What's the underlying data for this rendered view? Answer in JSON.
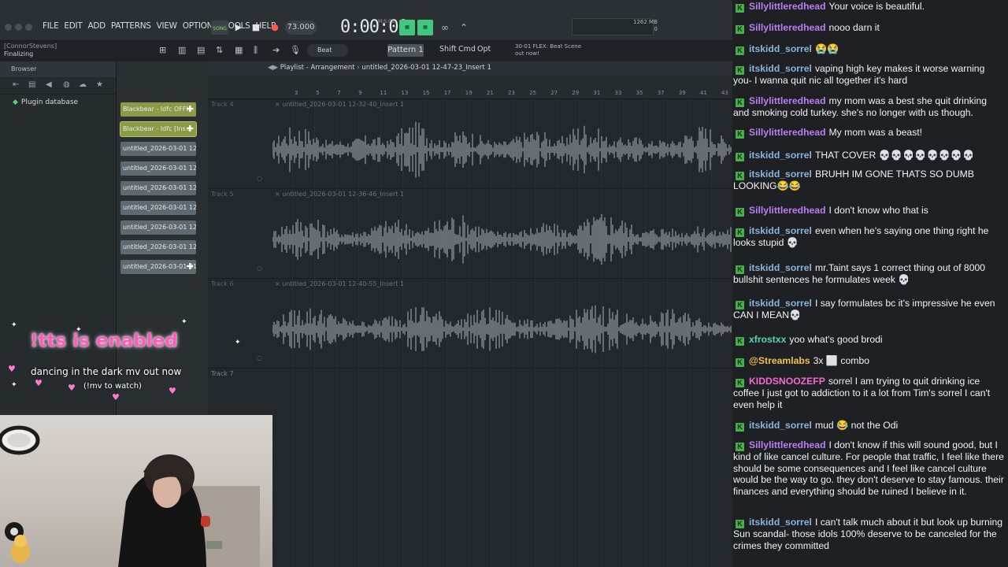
{
  "menu": {
    "items": [
      "FILE",
      "EDIT",
      "ADD",
      "PATTERNS",
      "VIEW",
      "OPTIONS",
      "TOOLS",
      "HELP"
    ],
    "song_label": "SONG",
    "tempo": "73.000",
    "time": "0:00:00",
    "time_unit": "M:S:CS",
    "cpu": "0",
    "ram": "1262 MB",
    "ram2": "0"
  },
  "user": {
    "name": "[ConnorStevens]",
    "status": "Finalizing"
  },
  "toolbar": {
    "beat": "Beat",
    "pattern": "Pattern 1",
    "shift": "Shift",
    "cmd": "Cmd",
    "opt": "Opt",
    "news_line1": "30-01 FLEX: Beat Scene",
    "news_line2": "out now!"
  },
  "browser": {
    "title": "Browser",
    "plugin_db": "Plugin database"
  },
  "channels": [
    {
      "label": "Blackbear - Idfc OFFI...",
      "color": "yellow"
    },
    {
      "label": "Blackbear - Idfc [Ins...",
      "color": "yellow"
    },
    {
      "label": "untitled_2026-03-01 12-...",
      "color": "gray"
    },
    {
      "label": "untitled_2026-03-01 12-...",
      "color": "gray"
    },
    {
      "label": "untitled_2026-03-01 12-...",
      "color": "gray"
    },
    {
      "label": "untitled_2026-03-01 12-...",
      "color": "gray"
    },
    {
      "label": "untitled_2026-03-01 12-...",
      "color": "gray"
    },
    {
      "label": "untitled_2026-03-01 12-...",
      "color": "gray"
    },
    {
      "label": "untitled_2026-03-01 01...",
      "color": "gray"
    }
  ],
  "playlist": {
    "title": "Playlist - Arrangement",
    "file": "untitled_2026-03-01 12-47-23_Insert 1",
    "ticks": [
      "3",
      "5",
      "7",
      "9",
      "11",
      "13",
      "15",
      "17",
      "19",
      "21",
      "23",
      "25",
      "27",
      "29",
      "31",
      "33",
      "35",
      "37",
      "39",
      "41",
      "43"
    ],
    "tracks": [
      {
        "label": "Track 4",
        "clip": "untitled_2026-03-01 12-32-40_Insert 1"
      },
      {
        "label": "Track 5",
        "clip": "untitled_2026-03-01 12-36-46_Insert 1"
      },
      {
        "label": "Track 6",
        "clip": "untitled_2026-03-01 12-40-55_Insert 1"
      }
    ],
    "empty_track": "Track 7"
  },
  "overlay": {
    "tts": "!tts is enabled",
    "mv": "dancing in the dark mv out now",
    "mv_sub": "(!mv to watch)"
  },
  "chat": [
    {
      "user": "Sillylittleredhead",
      "color": "purple",
      "text": "Your voice is beautiful."
    },
    {
      "user": "Sillylittleredhead",
      "color": "purple",
      "text": "nooo darn it"
    },
    {
      "user": "itskidd_sorrel",
      "color": "blue",
      "text": "😭😭"
    },
    {
      "user": "itskidd_sorrel",
      "color": "blue",
      "text": "vaping high key makes it worse warning you- I wanna quit nic all together it's hard"
    },
    {
      "user": "Sillylittleredhead",
      "color": "purple",
      "text": "my mom was a best she quit drinking and smoking cold turkey. she's no longer with us though."
    },
    {
      "user": "Sillylittleredhead",
      "color": "purple",
      "text": "My mom was a beast!"
    },
    {
      "user": "itskidd_sorrel",
      "color": "blue",
      "text": "THAT COVER 💀💀💀💀💀💀💀💀"
    },
    {
      "user": "itskidd_sorrel",
      "color": "blue",
      "text": "BRUHH IM GONE THATS SO DUMB LOOKING😂😂"
    },
    {
      "user": "Sillylittleredhead",
      "color": "purple",
      "text": "I don't know who that is"
    },
    {
      "user": "itskidd_sorrel",
      "color": "blue",
      "text": "even when he's saying one thing right he looks stupid 💀"
    },
    {
      "user": "itskidd_sorrel",
      "color": "blue",
      "text": "mr.Taint says 1 correct thing out of 8000 bullshit sentences he formulates week 💀"
    },
    {
      "user": "itskidd_sorrel",
      "color": "blue",
      "text": "I say formulates bc it's impressive he even CAN I MEAN💀"
    },
    {
      "user": "xfrostxx",
      "color": "teal",
      "text": "yoo what's good brodi"
    },
    {
      "user": "@Streamlabs",
      "color": "gold",
      "text": "3x ⬜ combo"
    },
    {
      "user": "KIDDSNOOZEFP",
      "color": "pink",
      "text": "sorrel I am trying to quit drinking ice coffee I just got to addiction to it a lot from Tim's sorrel I can't even help it"
    },
    {
      "user": "itskidd_sorrel",
      "color": "blue",
      "text": "mud 😂 not the Odi"
    },
    {
      "user": "Sillylittleredhead",
      "color": "purple",
      "text": "I don't know if this will sound good, but I kind of like cancel culture. For people that traffic, I feel like there should be some consequences and I feel like cancel culture would be the way to go. they don't deserve to stay famous. their finances and everything should be ruined I believe in it."
    },
    {
      "user": "itskidd_sorrel",
      "color": "blue",
      "text": "I can't talk much about it but look up burning Sun scandal- those idols 100% deserve to be canceled for the crimes they committed"
    }
  ]
}
